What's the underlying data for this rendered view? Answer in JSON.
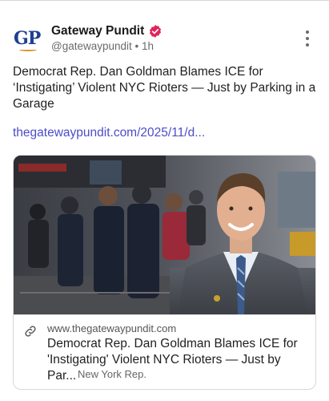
{
  "account": {
    "display_name": "Gateway Pundit",
    "handle": "@gatewaypundit",
    "separator": "•",
    "time_ago": "1h",
    "avatar_text": "GP",
    "verified_icon": "verified-badge-icon"
  },
  "post": {
    "text": "Democrat Rep. Dan Goldman Blames ICE for ‘Instigating’ Violent NYC Rioters — Just by Parking in a Garage",
    "link": "thegatewaypundit.com/2025/11/d..."
  },
  "link_card": {
    "domain": "www.thegatewaypundit.com",
    "title": "Democrat Rep. Dan Goldman Blames ICE for 'Instigating' Violent NYC Rioters — Just by Par...",
    "subtitle": "New York Rep.",
    "icon": "link-icon"
  },
  "colors": {
    "link": "#4c4cc9",
    "verified": "#e0245e",
    "brand_blue": "#1f3f8f",
    "brand_gold": "#d9982b"
  }
}
